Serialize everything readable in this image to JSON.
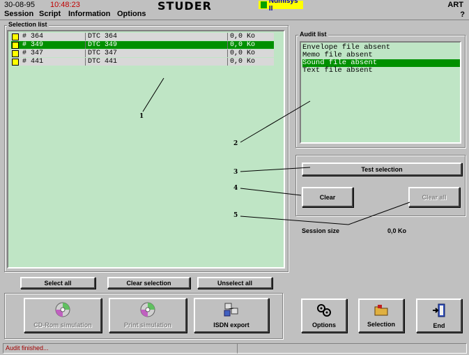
{
  "header": {
    "date": "30-08-95",
    "time": "10:48:23",
    "brand": "STUDER",
    "product": "Numisys II",
    "app_tag": "ART"
  },
  "menu": {
    "items": [
      "Session",
      "Script",
      "Information",
      "Options"
    ],
    "help": "?"
  },
  "selection_list": {
    "label": "Selection list",
    "rows": [
      {
        "id": "# 364",
        "name": "DTC 364",
        "size": "0,0 Ko",
        "selected": false
      },
      {
        "id": "# 349",
        "name": "DTC 349",
        "size": "0,0 Ko",
        "selected": true
      },
      {
        "id": "# 347",
        "name": "DTC 347",
        "size": "0,0 Ko",
        "selected": false
      },
      {
        "id": "# 441",
        "name": "DTC 441",
        "size": "0,0 Ko",
        "selected": false
      }
    ]
  },
  "audit_list": {
    "label": "Audit list",
    "items": [
      "Envelope file absent",
      "Memo file absent",
      "Sound file absent",
      "Text file absent"
    ],
    "selected_index": 2
  },
  "audit_panel": {
    "test_selection": "Test selection",
    "clear": "Clear",
    "clear_all": "Clear all",
    "session_size_label": "Session size",
    "session_size_value": "0,0 Ko"
  },
  "list_buttons": {
    "select_all": "Select all",
    "clear_selection": "Clear selection",
    "unselect_all": "Unselect all"
  },
  "bottom_buttons": {
    "cd_rom": "CD-Rom simulation",
    "print": "Print simulation",
    "isdn": "ISDN export",
    "options": "Options",
    "selection": "Selection",
    "end": "End"
  },
  "callouts": [
    "1",
    "2",
    "3",
    "4",
    "5"
  ],
  "status": {
    "message": "Audit finished..."
  },
  "icons": {
    "cd": "cd-disc-icon",
    "isdn": "network-computer-icon",
    "options": "gears-icon",
    "selection": "folder-icon",
    "end": "exit-door-icon"
  },
  "colors": {
    "list_bg": "#bfe5c5",
    "selected": "#009000",
    "time_red": "#c00000"
  }
}
